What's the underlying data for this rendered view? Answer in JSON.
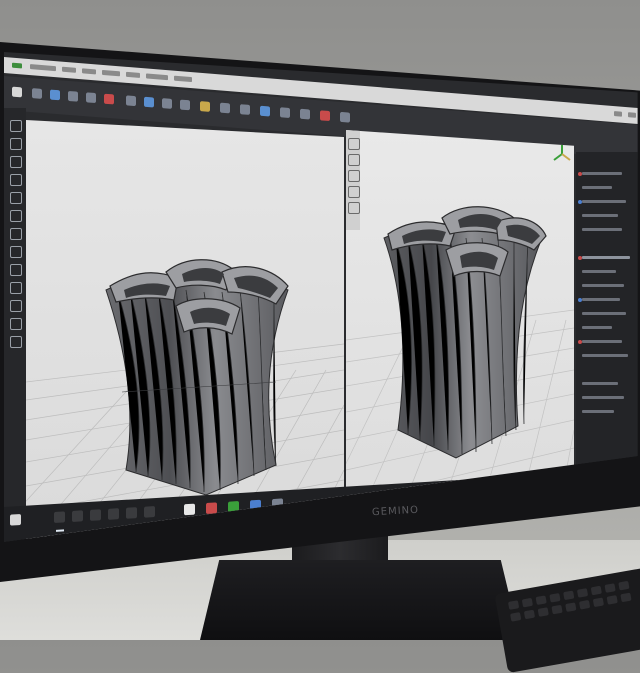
{
  "scene": {
    "monitor_brand": "GEMINO",
    "taskbar_label": "",
    "colors": {
      "bezel": "#141416",
      "viewport": "#e3e3e3",
      "model": "#5c5d61",
      "grid": "#b9b9b9",
      "ui_dark": "#2a2b2e"
    },
    "icons": [
      "menu-icon",
      "select-icon",
      "move-icon",
      "rotate-icon",
      "scale-icon",
      "view-cube-icon"
    ]
  }
}
